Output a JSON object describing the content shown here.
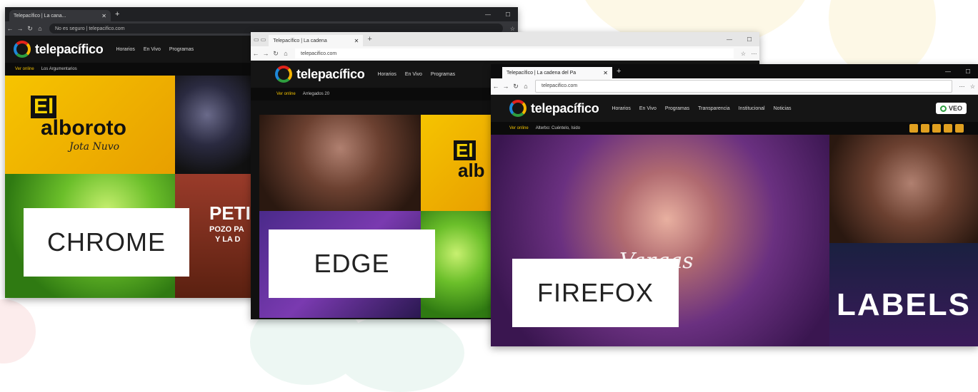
{
  "colors": {
    "bg_blob_yellow": "#fdf8e6",
    "bg_blob_teal": "#edf7f3",
    "bg_blob_pink": "#fcecec",
    "brand_yellow": "#f2c200",
    "site_dark": "#111111"
  },
  "windows": {
    "chrome": {
      "tab_title": "Telepacífico | La cana...",
      "url": "No es seguro | telepacifico.com",
      "label": "CHROME",
      "live_label": "Ver online",
      "live_sub": "Los Argumentarios"
    },
    "edge": {
      "tab_title": "Telepacífico | La cadena",
      "url": "telepacifico.com",
      "label": "EDGE",
      "live_label": "Ver online",
      "live_sub": "Arriegados 20"
    },
    "firefox": {
      "tab_title": "Telepacífico | La cadena del Pa",
      "url": "telepacifico.com",
      "label": "FIREFOX",
      "live_label": "Ver online",
      "live_sub": "Alterbo: Cuéntelo, Isido",
      "veo_label": "VEO"
    }
  },
  "site": {
    "logo_text": "telepacífico",
    "menu": [
      "Horarios",
      "En Vivo",
      "Programas",
      "Transparencia",
      "Institucional",
      "Noticias"
    ]
  },
  "tiles": {
    "alboroto_title_1": "El",
    "alboroto_title_2": "alboroto",
    "alboroto_sub": "Jota Nuvo",
    "petro_title": "PETI",
    "petro_sub_1": "POZO PA",
    "petro_sub_2": "Y LA D",
    "labels_text": "LABELS",
    "edge_el": "El",
    "edge_al": "alb",
    "vargas_script": "Vargas"
  },
  "icons": {
    "back": "arrow-left-icon",
    "forward": "arrow-right-icon",
    "reload": "reload-icon",
    "home": "home-icon",
    "close": "close-icon",
    "minimize": "minimize-icon",
    "maximize": "maximize-icon",
    "newtab": "plus-icon",
    "star": "star-icon",
    "menu": "menu-icon"
  }
}
